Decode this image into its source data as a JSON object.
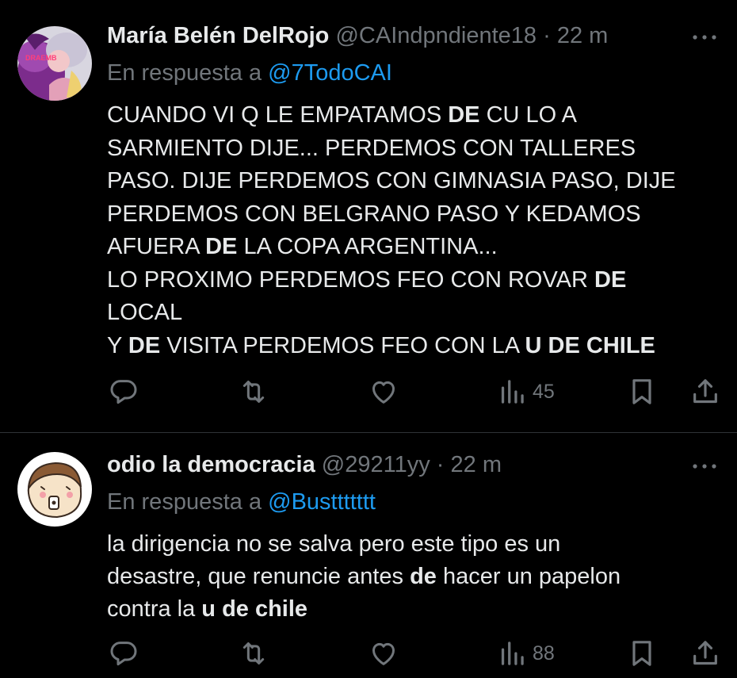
{
  "tweets": [
    {
      "display_name": "María Belén DelRojo",
      "handle": "@CAIndpndiente18",
      "separator": "·",
      "time": "22 m",
      "reply_prefix": "En respuesta a ",
      "reply_user": "@7TodoCAI",
      "avatar_text": "DRAEMB",
      "body_lines": [
        [
          {
            "t": "CUANDO VI Q LE EMPATAMOS ",
            "b": false
          },
          {
            "t": "DE",
            "b": true
          },
          {
            "t": " CU LO A",
            "b": false
          }
        ],
        [
          {
            "t": "SARMIENTO DIJE... PERDEMOS CON TALLERES",
            "b": false
          }
        ],
        [
          {
            "t": "PASO. DIJE PERDEMOS CON GIMNASIA PASO, DIJE",
            "b": false
          }
        ],
        [
          {
            "t": "PERDEMOS CON BELGRANO PASO Y KEDAMOS",
            "b": false
          }
        ],
        [
          {
            "t": "AFUERA ",
            "b": false
          },
          {
            "t": "DE",
            "b": true
          },
          {
            "t": " LA COPA ARGENTINA...",
            "b": false
          }
        ],
        [
          {
            "t": "LO PROXIMO PERDEMOS FEO CON ROVAR ",
            "b": false
          },
          {
            "t": "DE",
            "b": true
          }
        ],
        [
          {
            "t": "LOCAL",
            "b": false
          }
        ],
        [
          {
            "t": "Y ",
            "b": false
          },
          {
            "t": "DE",
            "b": true
          },
          {
            "t": " VISITA PERDEMOS FEO CON LA ",
            "b": false
          },
          {
            "t": "U DE CHILE",
            "b": true
          }
        ]
      ],
      "reply_count": "",
      "retweet_count": "",
      "like_count": "",
      "views_count": "45"
    },
    {
      "display_name": "odio la democracia",
      "handle": "@29211yy",
      "separator": "·",
      "time": "22 m",
      "reply_prefix": "En respuesta a ",
      "reply_user": "@Busttttttt",
      "body_lines": [
        [
          {
            "t": "la dirigencia no se salva pero este tipo es un",
            "b": false
          }
        ],
        [
          {
            "t": "desastre, que renuncie antes ",
            "b": false
          },
          {
            "t": "de",
            "b": true
          },
          {
            "t": " hacer un papelon",
            "b": false
          }
        ],
        [
          {
            "t": "contra la ",
            "b": false
          },
          {
            "t": "u de chile",
            "b": true
          }
        ]
      ],
      "reply_count": "",
      "retweet_count": "",
      "like_count": "",
      "views_count": "88"
    }
  ],
  "icons": {
    "more": "more-icon",
    "reply": "reply-icon",
    "retweet": "retweet-icon",
    "like": "heart-icon",
    "views": "views-icon",
    "bookmark": "bookmark-icon",
    "share": "share-icon"
  },
  "colors": {
    "background": "#000000",
    "text": "#e7e9ea",
    "muted": "#71767b",
    "link": "#1d9bf0",
    "divider": "#2f3336"
  }
}
